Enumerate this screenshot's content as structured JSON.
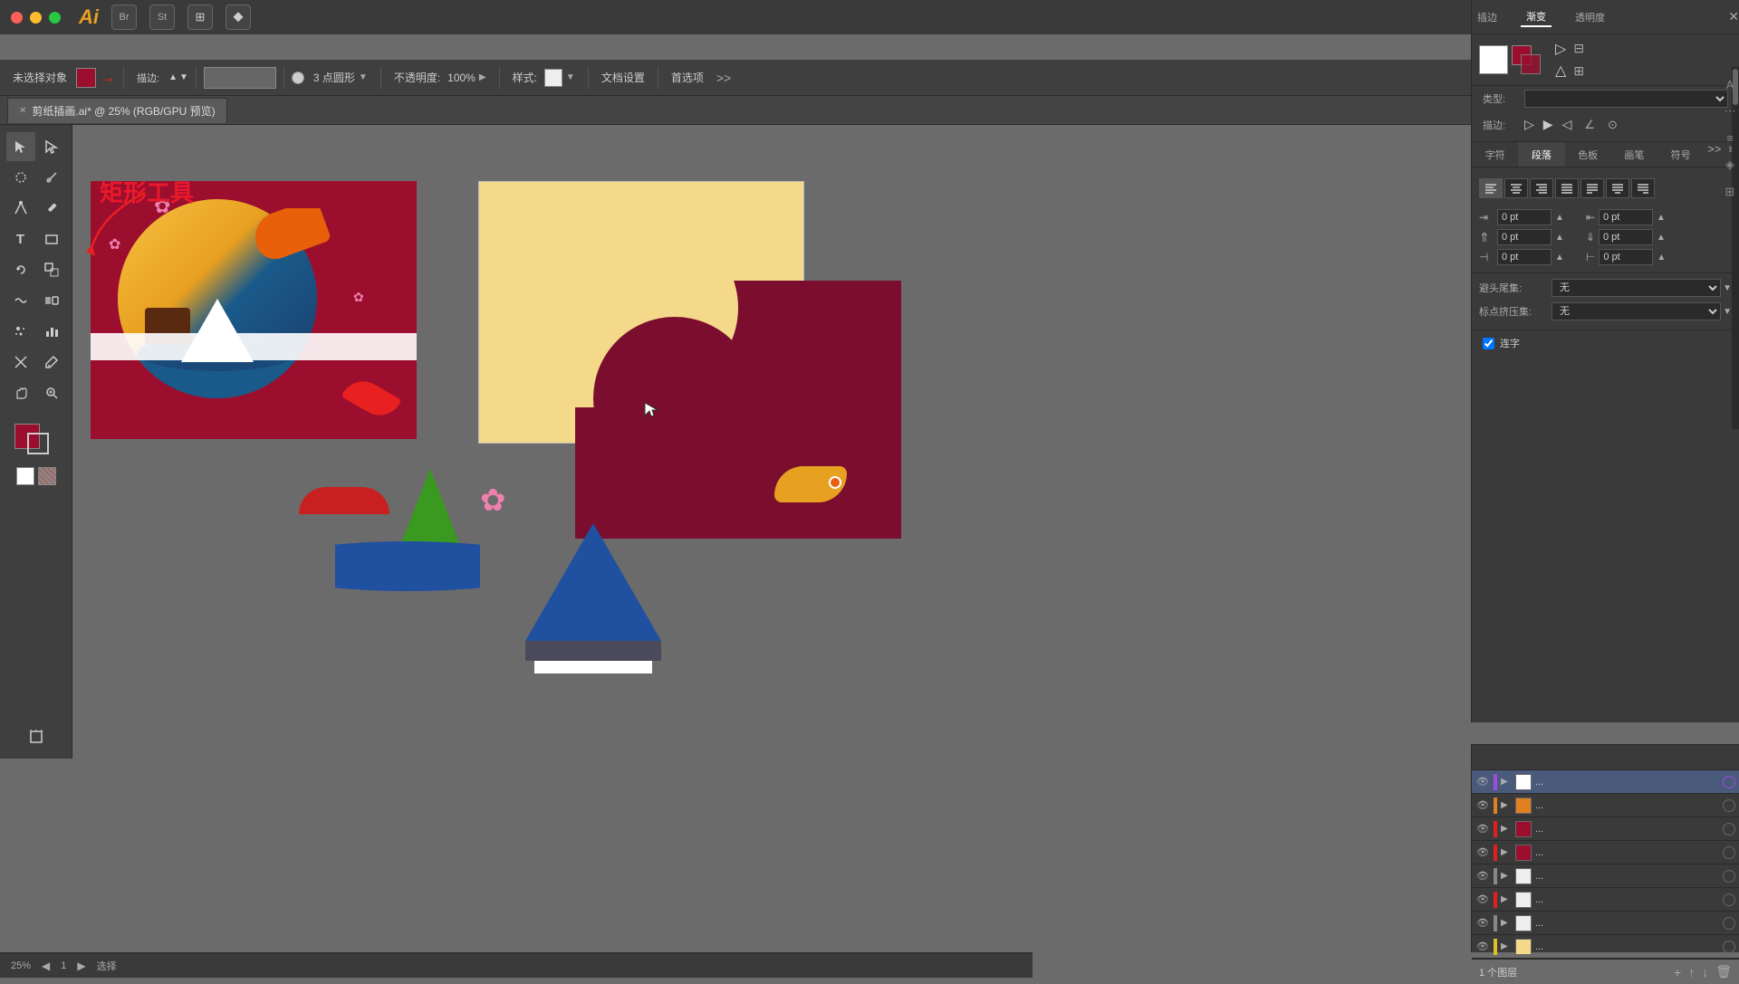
{
  "titlebar": {
    "app_name": "Ai",
    "traffic": [
      "red",
      "yellow",
      "green"
    ],
    "close_icon": "✕"
  },
  "menubar": {
    "items": [
      "插边",
      "渐变",
      "透明度"
    ]
  },
  "toolbar": {
    "no_selection_label": "未选择对象",
    "stroke_label": "描边:",
    "brush_size_label": "3 点圆形",
    "opacity_label": "不透明度:",
    "opacity_value": "100%",
    "style_label": "样式:",
    "doc_settings_label": "文档设置",
    "preferences_label": "首选项"
  },
  "tabbar": {
    "tab_name": "剪纸插画.ai* @ 25% (RGB/GPU 预览)",
    "tab_close": "✕"
  },
  "annotation": {
    "text": "矩形工具"
  },
  "tools": [
    {
      "name": "select",
      "icon": "↖"
    },
    {
      "name": "direct-select",
      "icon": "↗"
    },
    {
      "name": "lasso",
      "icon": "⌒"
    },
    {
      "name": "pen",
      "icon": "✒"
    },
    {
      "name": "pencil",
      "icon": "✏"
    },
    {
      "name": "text",
      "icon": "T"
    },
    {
      "name": "rect",
      "icon": "▭"
    },
    {
      "name": "rotate",
      "icon": "↻"
    },
    {
      "name": "scale",
      "icon": "⤡"
    },
    {
      "name": "warp",
      "icon": "〰"
    },
    {
      "name": "shape-builder",
      "icon": "⬡"
    },
    {
      "name": "eyedropper",
      "icon": "⊙"
    },
    {
      "name": "artboard",
      "icon": "▣"
    },
    {
      "name": "hand",
      "icon": "✋"
    },
    {
      "name": "zoom",
      "icon": "🔍"
    }
  ],
  "right_panel": {
    "tabs": [
      "插边",
      "渐变",
      "透明度"
    ],
    "close": "✕",
    "type_label": "类型:",
    "stroke_label": "描边:",
    "sub_tabs": [
      "字符",
      "段落",
      "色板",
      "画笔",
      "符号"
    ],
    "align_buttons": [
      "≡",
      "≡",
      "≡",
      "≡",
      "≡",
      "≡",
      "≡"
    ],
    "spacing": {
      "indent_left": "0 pt",
      "indent_right": "0 pt",
      "space_before": "0 pt",
      "space_after": "0 pt"
    },
    "no_wrap_label": "避头尾集:",
    "no_wrap_value": "无",
    "compress_label": "标点挤压集:",
    "compress_value": "无",
    "ligature_label": "连字",
    "ligature_checked": true
  },
  "layers": {
    "footer_label": "1 个图层",
    "items": [
      {
        "name": "...",
        "color": "#9b4de0",
        "active": true
      },
      {
        "name": "...",
        "color": "#e08020"
      },
      {
        "name": "...",
        "color": "#e02020"
      },
      {
        "name": "...",
        "color": "#e02020"
      },
      {
        "name": "...",
        "color": "#888888"
      },
      {
        "name": "...",
        "color": "#e02020"
      },
      {
        "name": "...",
        "color": "#888888"
      },
      {
        "name": "...",
        "color": "#e0c020"
      }
    ]
  },
  "statusbar": {
    "zoom": "25%",
    "artboard_info": "选择",
    "canvas_info": ""
  }
}
